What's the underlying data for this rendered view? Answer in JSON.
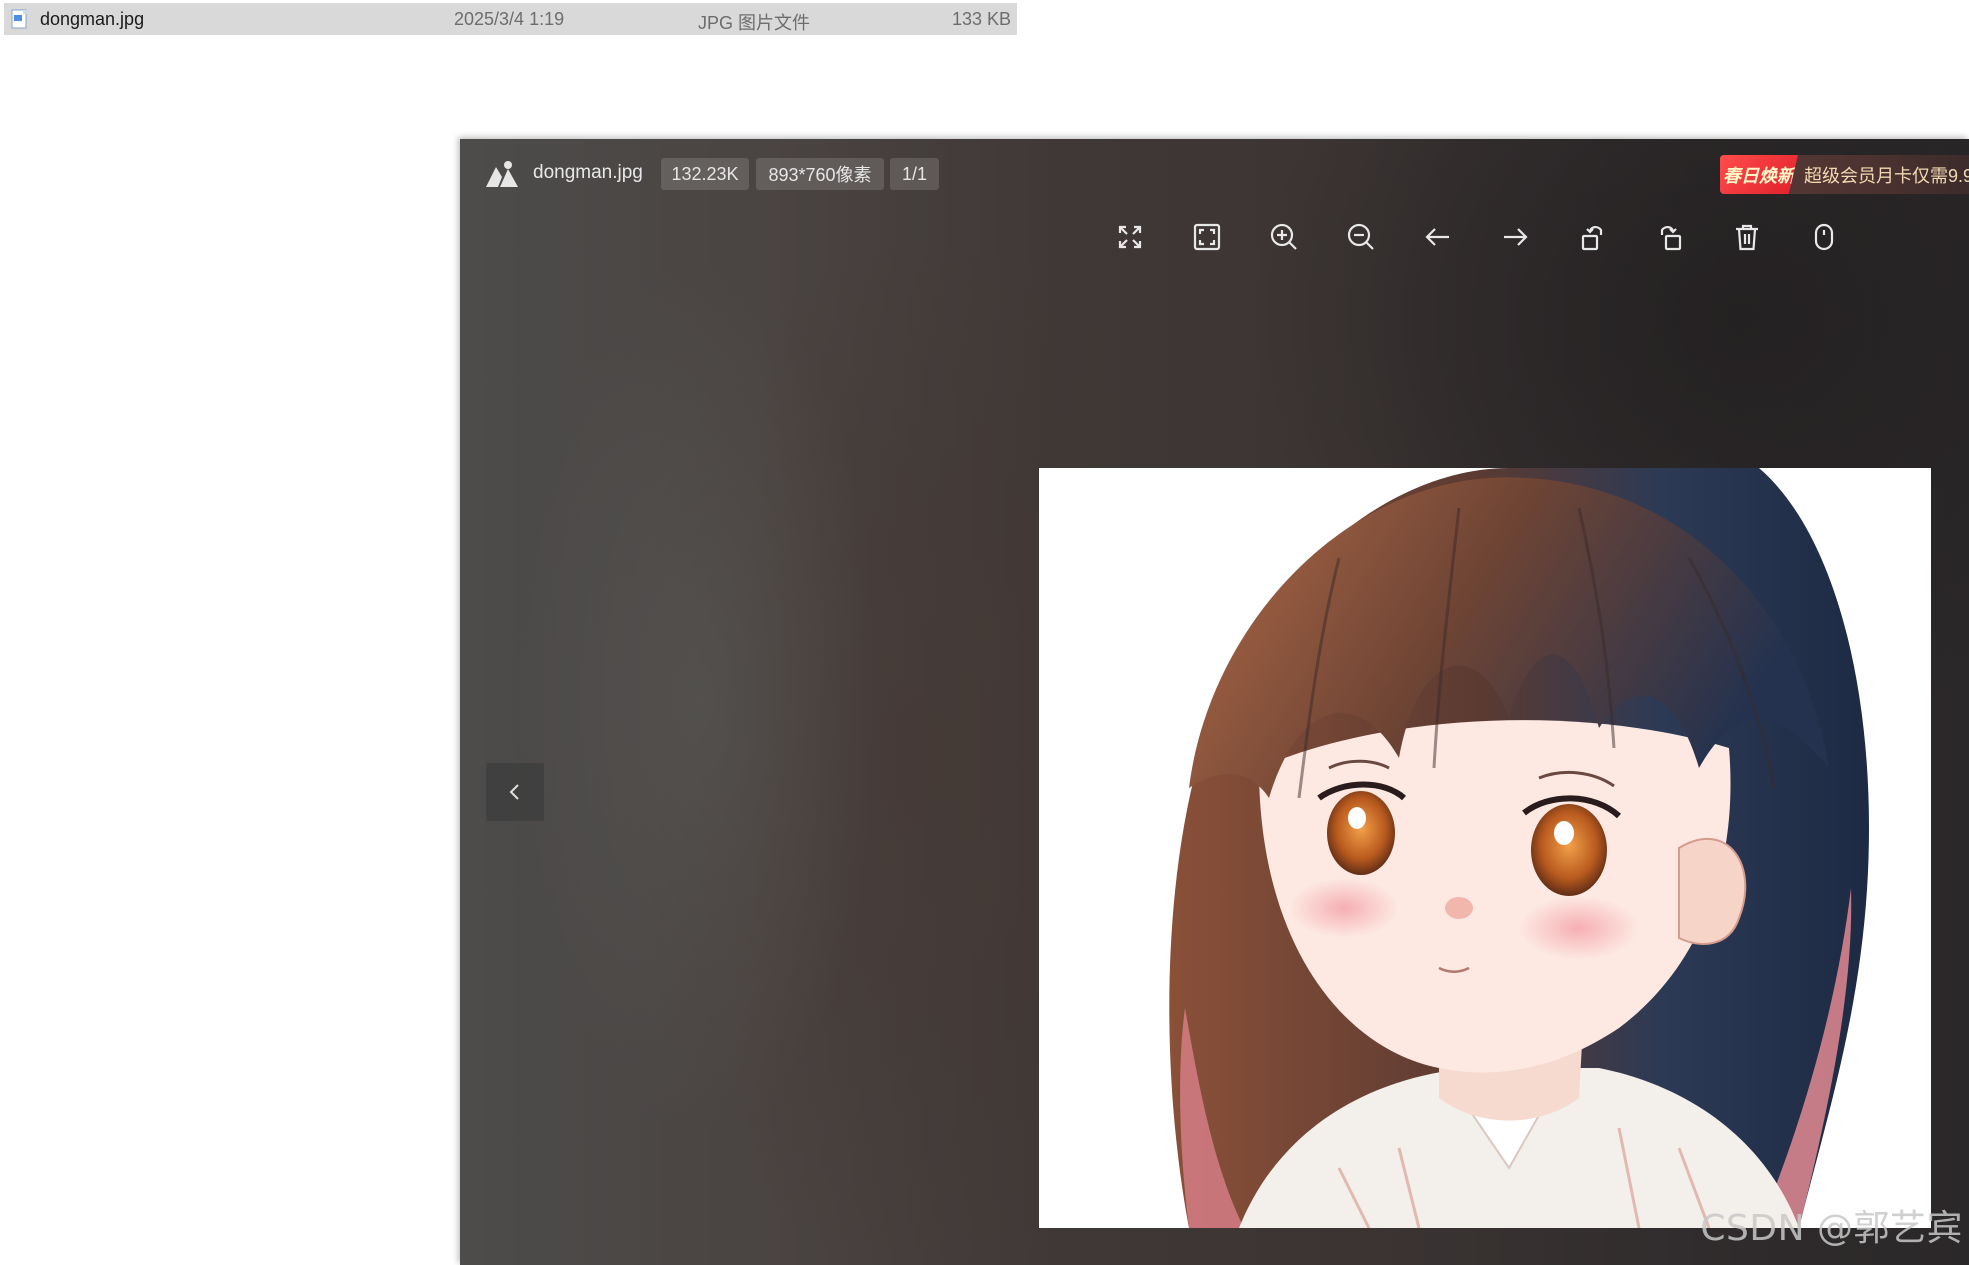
{
  "explorer": {
    "file": {
      "name": "dongman.jpg",
      "modified": "2025/3/4 1:19",
      "type": "JPG 图片文件",
      "size": "133 KB"
    }
  },
  "viewer": {
    "filename": "dongman.jpg",
    "file_size": "132.23K",
    "dimensions": "893*760像素",
    "page": "1/1",
    "promo": {
      "badge": "春日焕新",
      "text": "超级会员月卡仅需9.9"
    },
    "toolbar": [
      {
        "name": "fullscreen-icon"
      },
      {
        "name": "fit-window-icon"
      },
      {
        "name": "zoom-in-icon"
      },
      {
        "name": "zoom-out-icon"
      },
      {
        "name": "arrow-left-icon"
      },
      {
        "name": "arrow-right-icon"
      },
      {
        "name": "rotate-left-icon"
      },
      {
        "name": "rotate-right-icon"
      },
      {
        "name": "trash-icon"
      },
      {
        "name": "mouse-icon"
      }
    ]
  },
  "watermark": "CSDN @郭艺宾",
  "colors": {
    "explorer_selection": "#d9d9d9",
    "viewer_bg": "#3f3836",
    "promo_badge": "#e0202a",
    "promo_text": "#f3d9b1"
  }
}
